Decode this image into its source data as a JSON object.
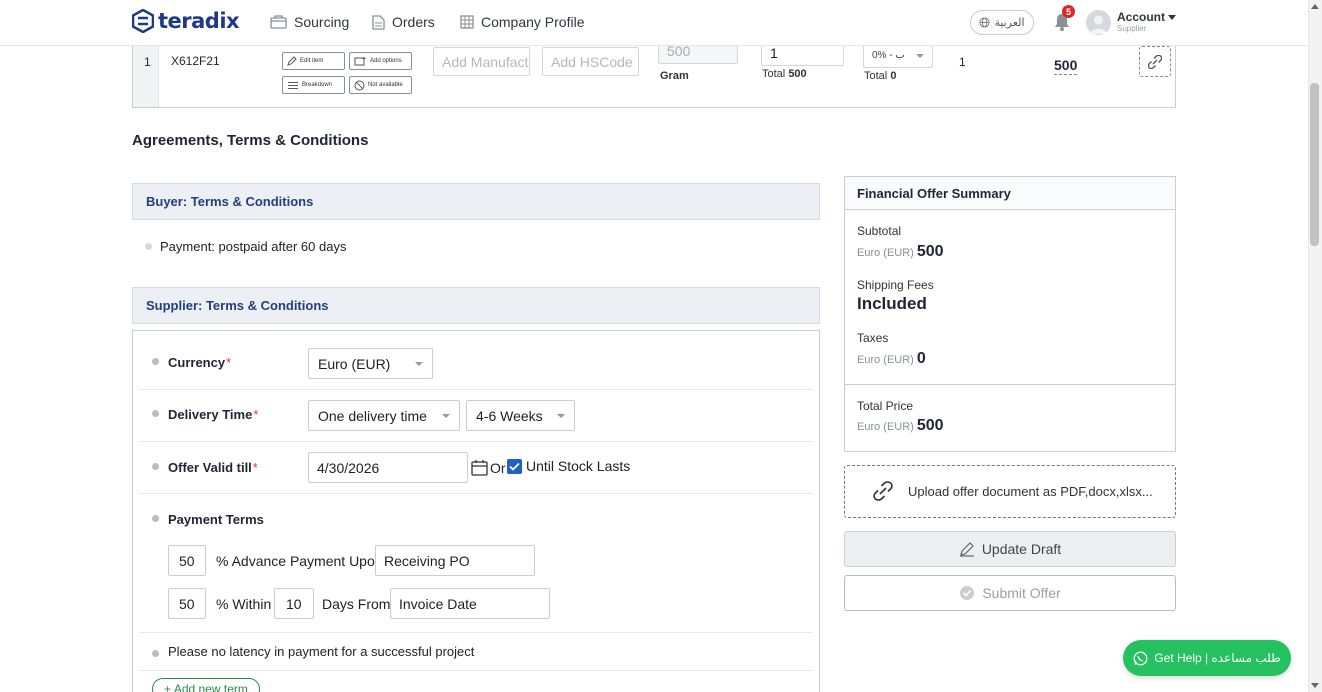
{
  "brand": {
    "name": "teradix",
    "color": "#1d3a8a"
  },
  "nav": {
    "sourcing": "Sourcing",
    "orders": "Orders",
    "company_profile": "Company Profile",
    "language": "العربية",
    "notifications_count": "5",
    "account_name": "Account",
    "account_role": "Supplier"
  },
  "item": {
    "index": "1",
    "code": "X612F21",
    "edit_label": "Edit item",
    "add_options_label": "Add options",
    "breakdown_label": "Breakdown",
    "not_available_label": "Not available",
    "manufacturer_placeholder": "Add Manufacturer",
    "hscode_placeholder": "Add HSCode",
    "unit_qty": "500",
    "unit": "Gram",
    "price_value": "1",
    "price_total_label": "Total",
    "price_total_value": "500",
    "tax_select": "0% - ب",
    "tax_total_label": "Total",
    "tax_total_value": "0",
    "quantity": "1",
    "line_total": "500"
  },
  "section_heading": "Agreements, Terms & Conditions",
  "buyer_terms": {
    "title": "Buyer: Terms & Conditions",
    "items": [
      "Payment: postpaid after 60 days"
    ]
  },
  "supplier_terms": {
    "title": "Supplier: Terms & Conditions",
    "currency_label": "Currency",
    "currency_value": "Euro (EUR)",
    "delivery_label": "Delivery Time",
    "delivery_type": "One delivery time",
    "delivery_period": "4-6 Weeks",
    "offer_valid_label": "Offer Valid till",
    "offer_valid_date": "4/30/2026",
    "or_text": "Or",
    "until_stock_label": "Until Stock Lasts",
    "until_stock_checked": true,
    "payment_terms_label": "Payment Terms",
    "advance_percent": "50",
    "advance_text": "% Advance Payment Upon",
    "advance_event": "Receiving PO",
    "within_percent": "50",
    "within_text": "% Within",
    "within_days": "10",
    "days_from_text": "Days From",
    "days_from_event": "Invoice Date",
    "custom_term": "Please no latency in payment for a successful project",
    "add_term_label": "+ Add new term"
  },
  "summary": {
    "title": "Financial Offer Summary",
    "subtotal_label": "Subtotal",
    "subtotal_currency": "Euro (EUR)",
    "subtotal_value": "500",
    "shipping_label": "Shipping Fees",
    "shipping_value": "Included",
    "taxes_label": "Taxes",
    "taxes_currency": "Euro (EUR)",
    "taxes_value": "0",
    "total_label": "Total Price",
    "total_currency": "Euro (EUR)",
    "total_value": "500"
  },
  "upload_label": "Upload offer document as PDF,docx,xlsx...",
  "update_draft_label": "Update Draft",
  "submit_offer_label": "Submit Offer",
  "help_label": "Get Help | طلب مساعده",
  "colors": {
    "accent_blue": "#2160c8",
    "help_green": "#25c05f",
    "required_red": "#d9363e"
  }
}
